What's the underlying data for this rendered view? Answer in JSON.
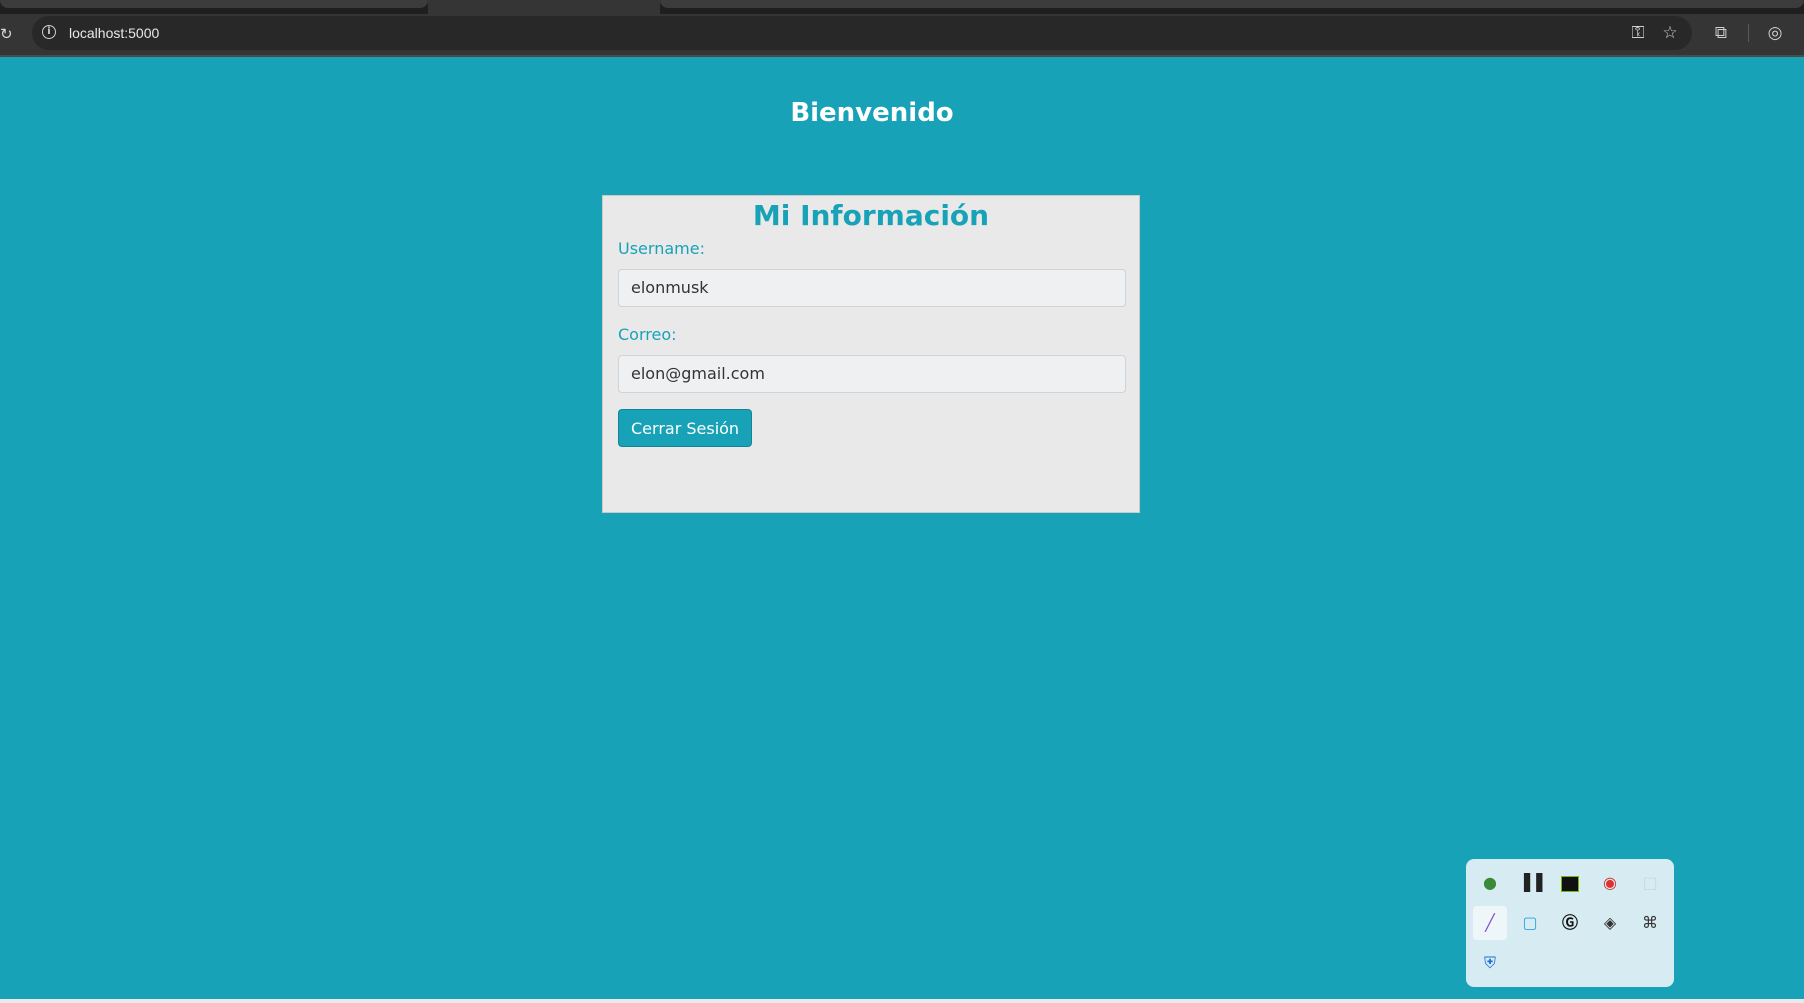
{
  "browser": {
    "url": "localhost:5000",
    "reload_icon": "reload-icon",
    "site_info_icon": "info-icon",
    "password_icon": "key-icon",
    "bookmark_icon": "star-icon",
    "extensions_icon": "puzzle-icon",
    "profile_icon": "profile-icon"
  },
  "page": {
    "title": "Bienvenido",
    "background": "#18a2b8"
  },
  "card": {
    "title": "Mi Información",
    "username_label": "Username:",
    "username_value": "elonmusk",
    "email_label": "Correo:",
    "email_value": "elon@gmail.com",
    "logout_button": "Cerrar Sesión"
  },
  "tray": {
    "icons": [
      "globe-app-icon",
      "bars-app-icon",
      "nvidia-icon",
      "red-app-icon",
      "window-icon",
      "pen-icon",
      "blue-square-icon",
      "g-circle-icon",
      "eye-icon",
      "network-icon",
      "shield-warning-icon"
    ]
  }
}
